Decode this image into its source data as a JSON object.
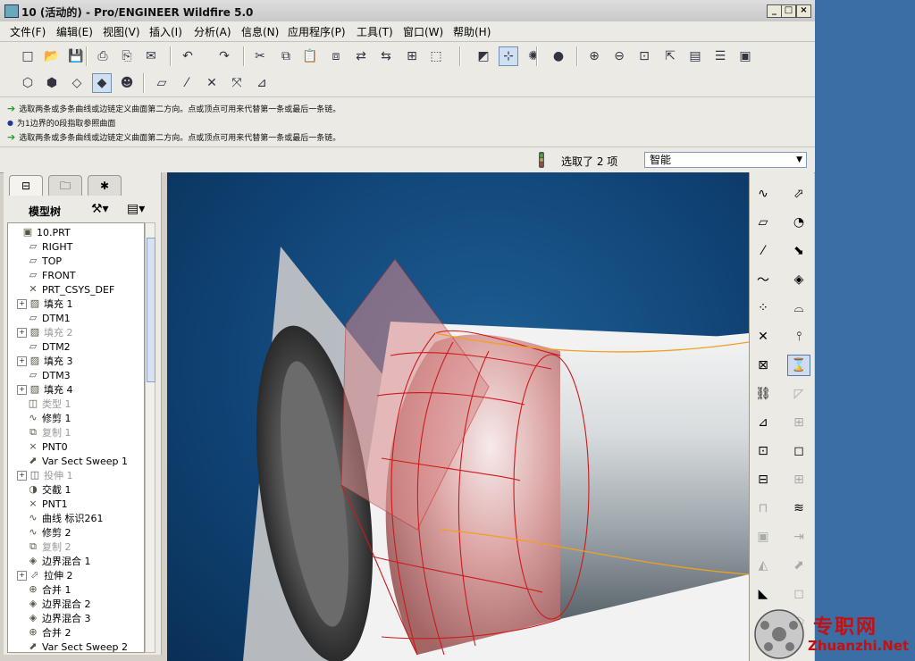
{
  "window": {
    "title": "10 (活动的) - Pro/ENGINEER Wildfire 5.0"
  },
  "menu": [
    "文件(F)",
    "编辑(E)",
    "视图(V)",
    "插入(I)",
    "分析(A)",
    "信息(N)",
    "应用程序(P)",
    "工具(T)",
    "窗口(W)",
    "帮助(H)"
  ],
  "messages": [
    {
      "type": "prompt",
      "text": "选取两条或多条曲线或边链定义曲面第二方向。点或顶点可用来代替第一条或最后一条链。"
    },
    {
      "type": "info",
      "text": "为1边界的0段指取参照曲面"
    },
    {
      "type": "prompt",
      "text": "选取两条或多条曲线或边链定义曲面第二方向。点或顶点可用来代替第一条或最后一条链。"
    }
  ],
  "status": {
    "selection": "选取了 2 项",
    "filter": "智能"
  },
  "model_tree": {
    "title": "模型树",
    "items": [
      {
        "label": "10.PRT",
        "icon": "part-icon",
        "expand": false,
        "indent": 0,
        "dim": false
      },
      {
        "label": "RIGHT",
        "icon": "datum-plane-icon",
        "expand": false,
        "indent": 1,
        "dim": false
      },
      {
        "label": "TOP",
        "icon": "datum-plane-icon",
        "expand": false,
        "indent": 1,
        "dim": false
      },
      {
        "label": "FRONT",
        "icon": "datum-plane-icon",
        "expand": false,
        "indent": 1,
        "dim": false
      },
      {
        "label": "PRT_CSYS_DEF",
        "icon": "csys-icon",
        "expand": false,
        "indent": 1,
        "dim": false
      },
      {
        "label": "填充 1",
        "icon": "fill-icon",
        "expand": true,
        "indent": 1,
        "dim": false
      },
      {
        "label": "DTM1",
        "icon": "datum-plane-icon",
        "expand": false,
        "indent": 1,
        "dim": false
      },
      {
        "label": "填充 2",
        "icon": "fill-icon",
        "expand": true,
        "indent": 1,
        "dim": true
      },
      {
        "label": "DTM2",
        "icon": "datum-plane-icon",
        "expand": false,
        "indent": 1,
        "dim": false
      },
      {
        "label": "填充 3",
        "icon": "fill-icon",
        "expand": true,
        "indent": 1,
        "dim": false
      },
      {
        "label": "DTM3",
        "icon": "datum-plane-icon",
        "expand": false,
        "indent": 1,
        "dim": false
      },
      {
        "label": "填充 4",
        "icon": "fill-icon",
        "expand": true,
        "indent": 1,
        "dim": false
      },
      {
        "label": "类型 1",
        "icon": "feature-icon",
        "expand": false,
        "indent": 1,
        "dim": true
      },
      {
        "label": "修剪 1",
        "icon": "curve-icon",
        "expand": false,
        "indent": 1,
        "dim": false
      },
      {
        "label": "复制 1",
        "icon": "copy-icon",
        "expand": false,
        "indent": 1,
        "dim": true
      },
      {
        "label": "PNT0",
        "icon": "point-icon",
        "expand": false,
        "indent": 1,
        "dim": false
      },
      {
        "label": "Var Sect Sweep 1",
        "icon": "sweep-icon",
        "expand": false,
        "indent": 1,
        "dim": false
      },
      {
        "label": "投伸 1",
        "icon": "feature-icon",
        "expand": true,
        "indent": 1,
        "dim": true
      },
      {
        "label": "交截 1",
        "icon": "intersect-icon",
        "expand": false,
        "indent": 1,
        "dim": false
      },
      {
        "label": "PNT1",
        "icon": "point-icon",
        "expand": false,
        "indent": 1,
        "dim": false
      },
      {
        "label": "曲线 标识261",
        "icon": "curve-icon",
        "expand": false,
        "indent": 1,
        "dim": false
      },
      {
        "label": "修剪 2",
        "icon": "curve-icon",
        "expand": false,
        "indent": 1,
        "dim": false
      },
      {
        "label": "复制 2",
        "icon": "copy-icon",
        "expand": false,
        "indent": 1,
        "dim": true
      },
      {
        "label": "边界混合 1",
        "icon": "blend-icon",
        "expand": false,
        "indent": 1,
        "dim": false
      },
      {
        "label": "拉伸 2",
        "icon": "extrude-icon",
        "expand": true,
        "indent": 1,
        "dim": false
      },
      {
        "label": "合并 1",
        "icon": "merge-icon",
        "expand": false,
        "indent": 1,
        "dim": false
      },
      {
        "label": "边界混合 2",
        "icon": "blend-icon",
        "expand": false,
        "indent": 1,
        "dim": false
      },
      {
        "label": "边界混合 3",
        "icon": "blend-icon",
        "expand": false,
        "indent": 1,
        "dim": false
      },
      {
        "label": "合并 2",
        "icon": "merge-icon",
        "expand": false,
        "indent": 1,
        "dim": false
      },
      {
        "label": "Var Sect Sweep 2",
        "icon": "sweep-icon",
        "expand": false,
        "indent": 1,
        "dim": false
      }
    ]
  },
  "toolbar1": [
    {
      "name": "new-icon",
      "glyph": "□"
    },
    {
      "name": "open-icon",
      "glyph": "📂"
    },
    {
      "name": "save-icon",
      "glyph": "💾"
    },
    {
      "name": "print-icon",
      "glyph": "⎙"
    },
    {
      "name": "print-preview-icon",
      "glyph": "⎘"
    },
    {
      "name": "email-icon",
      "glyph": "✉"
    },
    {
      "name": "undo-icon",
      "glyph": "↶"
    },
    {
      "name": "redo-icon",
      "glyph": "↷"
    },
    {
      "name": "cut-icon",
      "glyph": "✂"
    },
    {
      "name": "copy-icon",
      "glyph": "⧉"
    },
    {
      "name": "paste-icon",
      "glyph": "📋"
    },
    {
      "name": "paste-special-icon",
      "glyph": "⧈"
    },
    {
      "name": "regenerate-icon",
      "glyph": "⇄"
    },
    {
      "name": "regenerate-manager-icon",
      "glyph": "⇆"
    },
    {
      "name": "find-icon",
      "glyph": "⊞"
    },
    {
      "name": "selection-box-icon",
      "glyph": "⬚"
    },
    {
      "name": "sketch-icon",
      "glyph": "◩"
    },
    {
      "name": "datum-display-icon",
      "glyph": "⊹"
    },
    {
      "name": "spin-center-icon",
      "glyph": "✺"
    },
    {
      "name": "shading-sphere-icon",
      "glyph": "●"
    },
    {
      "name": "zoom-in-icon",
      "glyph": "⊕"
    },
    {
      "name": "zoom-out-icon",
      "glyph": "⊖"
    },
    {
      "name": "refit-icon",
      "glyph": "⊡"
    },
    {
      "name": "reorient-icon",
      "glyph": "⇱"
    },
    {
      "name": "saved-views-icon",
      "glyph": "▤"
    },
    {
      "name": "layers-icon",
      "glyph": "☰"
    },
    {
      "name": "view-manager-icon",
      "glyph": "▣"
    }
  ],
  "toolbar2": [
    {
      "name": "wireframe-icon",
      "glyph": "⬡"
    },
    {
      "name": "hidden-line-icon",
      "glyph": "⬢"
    },
    {
      "name": "no-hidden-icon",
      "glyph": "◇"
    },
    {
      "name": "shading-icon",
      "glyph": "◆"
    },
    {
      "name": "enhanced-realism-icon",
      "glyph": "☻"
    },
    {
      "name": "plane-display-icon",
      "glyph": "▱"
    },
    {
      "name": "axis-display-icon",
      "glyph": "⁄"
    },
    {
      "name": "point-display-icon",
      "glyph": "✕"
    },
    {
      "name": "csys-display-icon",
      "glyph": "⤧"
    },
    {
      "name": "annotation-display-icon",
      "glyph": "⊿"
    }
  ],
  "right_toolbar_left": [
    {
      "name": "sketched-curve-icon",
      "glyph": "∿",
      "dim": false
    },
    {
      "name": "datum-plane-tool-icon",
      "glyph": "▱",
      "dim": false
    },
    {
      "name": "datum-axis-tool-icon",
      "glyph": "⁄",
      "dim": false
    },
    {
      "name": "datum-curve-tool-icon",
      "glyph": "〜",
      "dim": false
    },
    {
      "name": "datum-point-tool-icon",
      "glyph": "⁘",
      "dim": false
    },
    {
      "name": "csys-tool-icon",
      "glyph": "✕",
      "dim": false
    },
    {
      "name": "analysis-feature-icon",
      "glyph": "⊠",
      "dim": false
    },
    {
      "name": "chain-link-icon",
      "glyph": "⛓",
      "dim": false
    },
    {
      "name": "insert-shared-data-icon",
      "glyph": "⊿",
      "dim": false
    },
    {
      "name": "copy-geometry-icon",
      "glyph": "⊡",
      "dim": false
    },
    {
      "name": "publish-geometry-icon",
      "glyph": "⊟",
      "dim": false
    },
    {
      "name": "hole-tool-icon",
      "glyph": "⊓",
      "dim": true
    },
    {
      "name": "shell-tool-icon",
      "glyph": "▣",
      "dim": true
    },
    {
      "name": "draft-tool-icon",
      "glyph": "◭",
      "dim": true
    },
    {
      "name": "round-tool-icon",
      "glyph": "◣",
      "dim": false
    },
    {
      "name": "chamfer-tool-icon",
      "glyph": "◢",
      "dim": false
    }
  ],
  "right_toolbar_right": [
    {
      "name": "extrude-tool-icon",
      "glyph": "⬀",
      "dim": false,
      "active": false
    },
    {
      "name": "revolve-tool-icon",
      "glyph": "◔",
      "dim": false,
      "active": false
    },
    {
      "name": "variable-sweep-tool-icon",
      "glyph": "⬊",
      "dim": false,
      "active": false
    },
    {
      "name": "boundary-blend-tool-icon",
      "glyph": "◈",
      "dim": false,
      "active": false
    },
    {
      "name": "style-tool-icon",
      "glyph": "⌓",
      "dim": false,
      "active": false
    },
    {
      "name": "mirror-tool-icon",
      "glyph": "⫯",
      "dim": false,
      "active": false
    },
    {
      "name": "offset-tool-icon",
      "glyph": "⌛",
      "dim": false,
      "active": true
    },
    {
      "name": "trim-tool-icon",
      "glyph": "◸",
      "dim": true,
      "active": false
    },
    {
      "name": "pattern-tool-icon",
      "glyph": "⊞",
      "dim": true,
      "active": false
    },
    {
      "name": "fill-tool-icon",
      "glyph": "◻",
      "dim": false,
      "active": false
    },
    {
      "name": "merge-tool-icon",
      "glyph": "⊞",
      "dim": true,
      "active": false
    },
    {
      "name": "warp-tool-icon",
      "glyph": "≋",
      "dim": false,
      "active": false
    },
    {
      "name": "extend-tool-icon",
      "glyph": "⇥",
      "dim": true,
      "active": false
    },
    {
      "name": "thicken-tool-icon",
      "glyph": "⬈",
      "dim": true,
      "active": false
    },
    {
      "name": "solidify-tool-icon",
      "glyph": "◻",
      "dim": true,
      "active": false
    },
    {
      "name": "project-tool-icon",
      "glyph": "⬠",
      "dim": true,
      "active": false
    }
  ],
  "watermark": {
    "line1": "专职网",
    "line2": "Zhuanzhi.Net"
  }
}
